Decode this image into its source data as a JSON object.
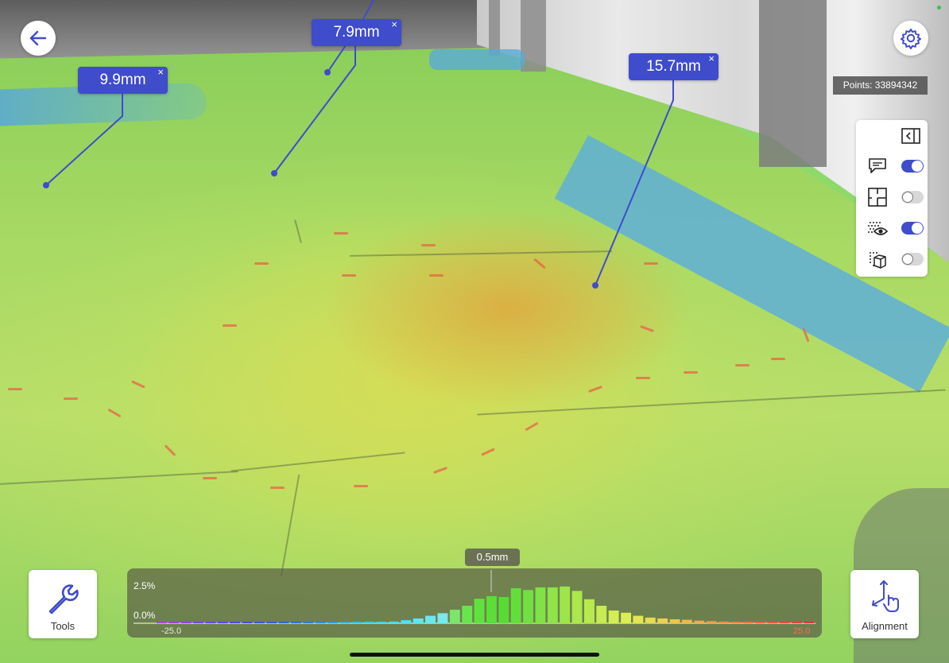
{
  "measurements": [
    {
      "value": "9.9mm",
      "close": "×"
    },
    {
      "value": "7.9mm",
      "close": "×"
    },
    {
      "value": "15.7mm",
      "close": "×"
    }
  ],
  "points": "Points: 33894342",
  "icons": {
    "back": "arrow-left-icon",
    "settings": "gear-icon",
    "collapse": "collapse-panel-icon",
    "annotations": "comment-icon",
    "floorplan": "floorplan-icon",
    "pointcloud": "eye-points-icon",
    "mesh": "mesh-icon",
    "tools": "wrench-icon",
    "alignment": "alignment-icon"
  },
  "layers": [
    {
      "name": "annotations",
      "on": true
    },
    {
      "name": "floorplan",
      "on": false
    },
    {
      "name": "pointcloud-visibility",
      "on": true
    },
    {
      "name": "mesh",
      "on": false
    }
  ],
  "tools_label": "Tools",
  "alignment_label": "Alignment",
  "histogram": {
    "y_max_label": "2.5%",
    "y_min_label": "0.0%",
    "x_min_label": "-25.0",
    "x_max_label": "25.0",
    "cursor_value": "0.5mm",
    "bars": [
      0.02,
      0.02,
      0.02,
      0.02,
      0.02,
      0.02,
      0.02,
      0.02,
      0.02,
      0.02,
      0.02,
      0.02,
      0.02,
      0.02,
      0.02,
      0.02,
      0.02,
      0.02,
      0.03,
      0.04,
      0.07,
      0.11,
      0.17,
      0.23,
      0.31,
      0.4,
      0.56,
      0.62,
      0.6,
      0.8,
      0.76,
      0.82,
      0.82,
      0.84,
      0.74,
      0.55,
      0.4,
      0.29,
      0.24,
      0.17,
      0.13,
      0.11,
      0.09,
      0.08,
      0.06,
      0.05,
      0.04,
      0.03,
      0.03,
      0.03,
      0.03,
      0.02,
      0.02,
      0.02
    ],
    "colors": [
      "#b640d8",
      "#a040e0",
      "#8c42e6",
      "#7a44e8",
      "#6a46e8",
      "#5a48e6",
      "#4c4ae2",
      "#4050de",
      "#3858da",
      "#3060d6",
      "#2a6ad2",
      "#2676d2",
      "#2482d4",
      "#2490d6",
      "#26a0da",
      "#2ab0de",
      "#30c0e2",
      "#38cce6",
      "#40d4ea",
      "#48dcee",
      "#52e2f0",
      "#5ee6f2",
      "#6ae8f0",
      "#78eaee",
      "#7ae66a",
      "#6ae44e",
      "#60e23e",
      "#5ade38",
      "#5ada36",
      "#64de3c",
      "#72e040",
      "#80e244",
      "#8ee448",
      "#9ce64a",
      "#aae84c",
      "#b8ea4e",
      "#c6ec50",
      "#d2ee52",
      "#dcec52",
      "#e4e652",
      "#e8dc50",
      "#ecd04e",
      "#eec44c",
      "#f0b84a",
      "#f0aa48",
      "#f09c46",
      "#ee8e44",
      "#ec8042",
      "#ea7240",
      "#e8643e",
      "#e6583c",
      "#e44c3a",
      "#e24238",
      "#e03836"
    ]
  }
}
